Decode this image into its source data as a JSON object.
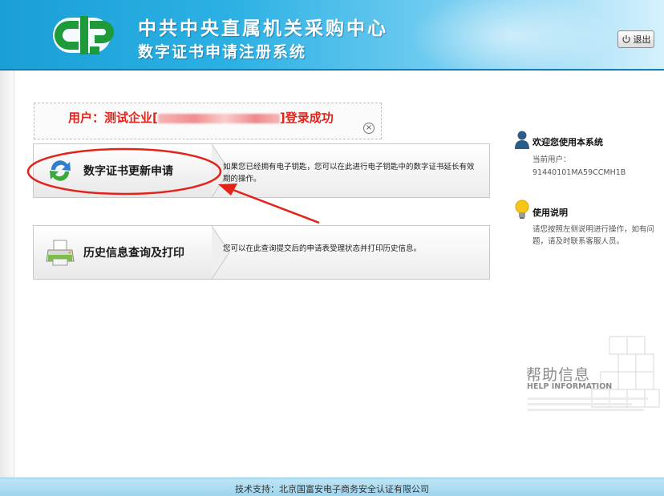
{
  "header": {
    "title": "中共中央直属机关采购中心",
    "subtitle": "数字证书申请注册系统",
    "logout_label": "退出"
  },
  "notice": {
    "prefix": "用户：测试企业[",
    "suffix": "]登录成功"
  },
  "menu": [
    {
      "title": "数字证书更新申请",
      "description": "如果您已经拥有电子钥匙，您可以在此进行电子钥匙中的数字证书延长有效期的操作。",
      "icon": "refresh-icon"
    },
    {
      "title": "历史信息查询及打印",
      "description": "您可以在此查询提交后的申请表受理状态并打印历史信息。",
      "icon": "printer-icon"
    }
  ],
  "sidebar": {
    "welcome_title": "欢迎您使用本系统",
    "current_user_label": "当前用户：",
    "current_user_value": "91440101MA59CCMH1B",
    "instructions_title": "使用说明",
    "instructions_text": "请您按照左侧说明进行操作，如有问题，请及时联系客服人员。"
  },
  "help": {
    "title_cn": "帮助信息",
    "title_en": "HELP INFORMATION"
  },
  "footer": {
    "text": "技术支持：北京国富安电子商务安全认证有限公司"
  },
  "colors": {
    "header_blue": "#1a9fd6",
    "logo_green": "#1f9a3b",
    "alert_red": "#e2231a"
  }
}
